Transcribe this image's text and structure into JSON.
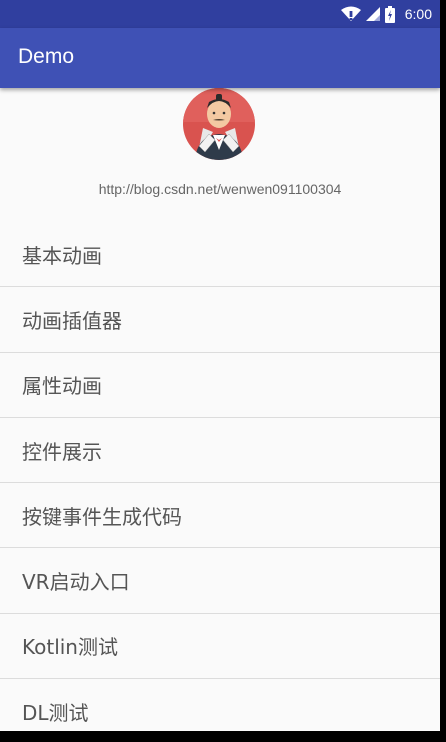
{
  "status_bar": {
    "time": "6:00",
    "icons": [
      "wifi-icon",
      "signal-icon",
      "battery-icon"
    ]
  },
  "app_bar": {
    "title": "Demo",
    "color": "#3f51b5",
    "status_color": "#303f9f"
  },
  "header": {
    "avatar": "avatar-illustration",
    "url": "http://blog.csdn.net/wenwen091100304"
  },
  "menu": {
    "items": [
      {
        "label": "基本动画"
      },
      {
        "label": "动画插值器"
      },
      {
        "label": "属性动画"
      },
      {
        "label": "控件展示"
      },
      {
        "label": "按键事件生成代码"
      },
      {
        "label": "VR启动入口"
      },
      {
        "label": "Kotlin测试"
      },
      {
        "label": "DL测试"
      }
    ]
  }
}
